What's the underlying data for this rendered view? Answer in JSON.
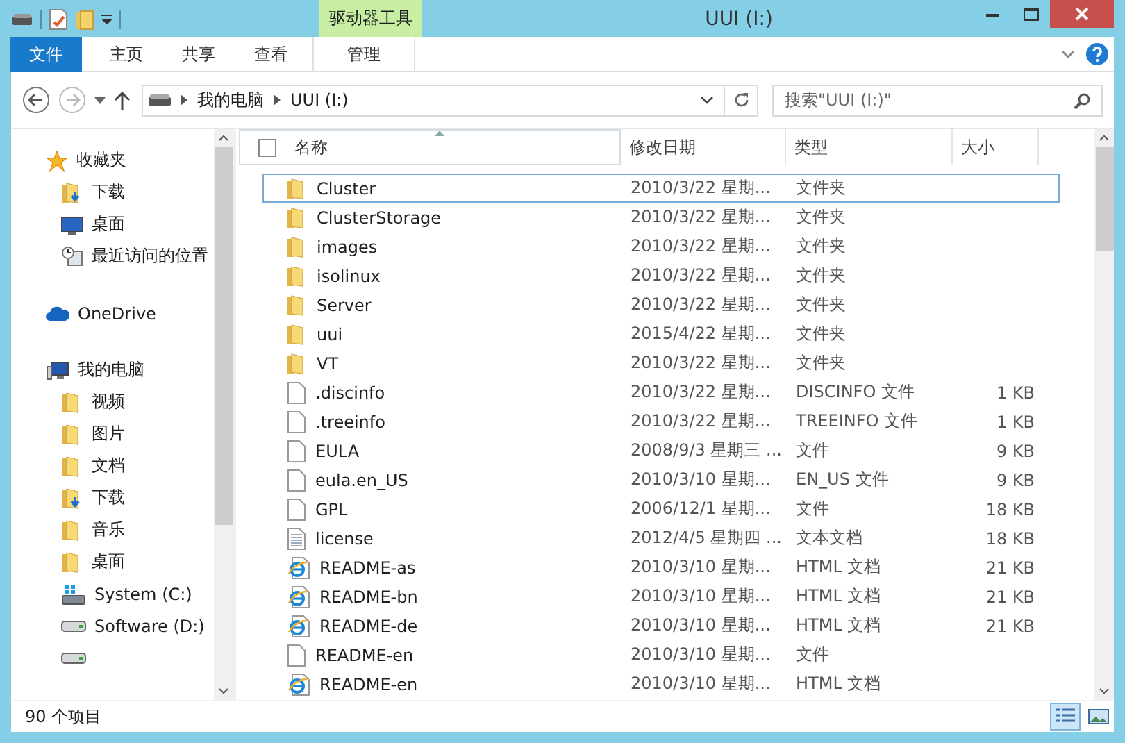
{
  "window": {
    "title": "UUI (I:)",
    "context_label": "驱动器工具"
  },
  "ribbon_tabs": [
    {
      "label": "文件",
      "kind": "file"
    },
    {
      "label": "主页",
      "kind": "tab"
    },
    {
      "label": "共享",
      "kind": "tab"
    },
    {
      "label": "查看",
      "kind": "tab"
    },
    {
      "label": "管理",
      "kind": "context"
    }
  ],
  "address": {
    "path": [
      "我的电脑",
      "UUI (I:)"
    ],
    "search_placeholder": "搜索\"UUI (I:)\""
  },
  "sidebar": [
    {
      "label": "收藏夹",
      "kind": "favorites",
      "children": [
        {
          "label": "下载",
          "kind": "download"
        },
        {
          "label": "桌面",
          "kind": "desktop"
        },
        {
          "label": "最近访问的位置",
          "kind": "recent"
        }
      ]
    },
    {
      "label": "OneDrive",
      "kind": "cloud"
    },
    {
      "label": "我的电脑",
      "kind": "computer",
      "children": [
        {
          "label": "视频",
          "kind": "folder"
        },
        {
          "label": "图片",
          "kind": "folder"
        },
        {
          "label": "文档",
          "kind": "folder"
        },
        {
          "label": "下载",
          "kind": "download"
        },
        {
          "label": "音乐",
          "kind": "folder"
        },
        {
          "label": "桌面",
          "kind": "folder"
        },
        {
          "label": "System (C:)",
          "kind": "system"
        },
        {
          "label": "Software (D:)",
          "kind": "drive"
        },
        {
          "kind": "drive"
        }
      ]
    }
  ],
  "select_all_checked": false,
  "columns": [
    {
      "label": "名称",
      "sorted": true
    },
    {
      "label": "修改日期",
      "sorted": false
    },
    {
      "label": "类型",
      "sorted": false
    },
    {
      "label": "大小",
      "sorted": false
    }
  ],
  "rows": [
    {
      "name": "Cluster",
      "date": "2010/3/22 星期...",
      "type": "文件夹",
      "kind": "folder",
      "focused": true
    },
    {
      "name": "ClusterStorage",
      "date": "2010/3/22 星期...",
      "type": "文件夹",
      "kind": "folder",
      "focused": false
    },
    {
      "name": "images",
      "date": "2010/3/22 星期...",
      "type": "文件夹",
      "kind": "folder",
      "focused": false
    },
    {
      "name": "isolinux",
      "date": "2010/3/22 星期...",
      "type": "文件夹",
      "kind": "folder",
      "focused": false
    },
    {
      "name": "Server",
      "date": "2010/3/22 星期...",
      "type": "文件夹",
      "kind": "folder",
      "focused": false
    },
    {
      "name": "uui",
      "date": "2015/4/22 星期...",
      "type": "文件夹",
      "kind": "folder",
      "focused": false
    },
    {
      "name": "VT",
      "date": "2010/3/22 星期...",
      "type": "文件夹",
      "kind": "folder",
      "focused": false
    },
    {
      "name": ".discinfo",
      "date": "2010/3/22 星期...",
      "type": "DISCINFO 文件",
      "size": "1 KB",
      "kind": "file",
      "focused": false
    },
    {
      "name": ".treeinfo",
      "date": "2010/3/22 星期...",
      "type": "TREEINFO 文件",
      "size": "1 KB",
      "kind": "file",
      "focused": false
    },
    {
      "name": "EULA",
      "date": "2008/9/3 星期三 ...",
      "type": "文件",
      "size": "9 KB",
      "kind": "file",
      "focused": false
    },
    {
      "name": "eula.en_US",
      "date": "2010/3/10 星期...",
      "type": "EN_US 文件",
      "size": "9 KB",
      "kind": "file",
      "focused": false
    },
    {
      "name": "GPL",
      "date": "2006/12/1 星期...",
      "type": "文件",
      "size": "18 KB",
      "kind": "file",
      "focused": false
    },
    {
      "name": "license",
      "date": "2012/4/5 星期四 ...",
      "type": "文本文档",
      "size": "18 KB",
      "kind": "text",
      "focused": false
    },
    {
      "name": "README-as",
      "date": "2010/3/10 星期...",
      "type": "HTML 文档",
      "size": "21 KB",
      "kind": "html",
      "focused": false
    },
    {
      "name": "README-bn",
      "date": "2010/3/10 星期...",
      "type": "HTML 文档",
      "size": "21 KB",
      "kind": "html",
      "focused": false
    },
    {
      "name": "README-de",
      "date": "2010/3/10 星期...",
      "type": "HTML 文档",
      "size": "21 KB",
      "kind": "html",
      "focused": false
    },
    {
      "name": "README-en",
      "date": "2010/3/10 星期...",
      "type": "文件",
      "kind": "file",
      "focused": false
    },
    {
      "name": "README-en",
      "date": "2010/3/10 星期...",
      "type": "HTML 文档",
      "kind": "html",
      "focused": false
    }
  ],
  "status_bar": {
    "count": "90 个项目"
  },
  "view_buttons": [
    {
      "kind": "details",
      "selected": true
    },
    {
      "kind": "thumbnails",
      "selected": false
    }
  ]
}
